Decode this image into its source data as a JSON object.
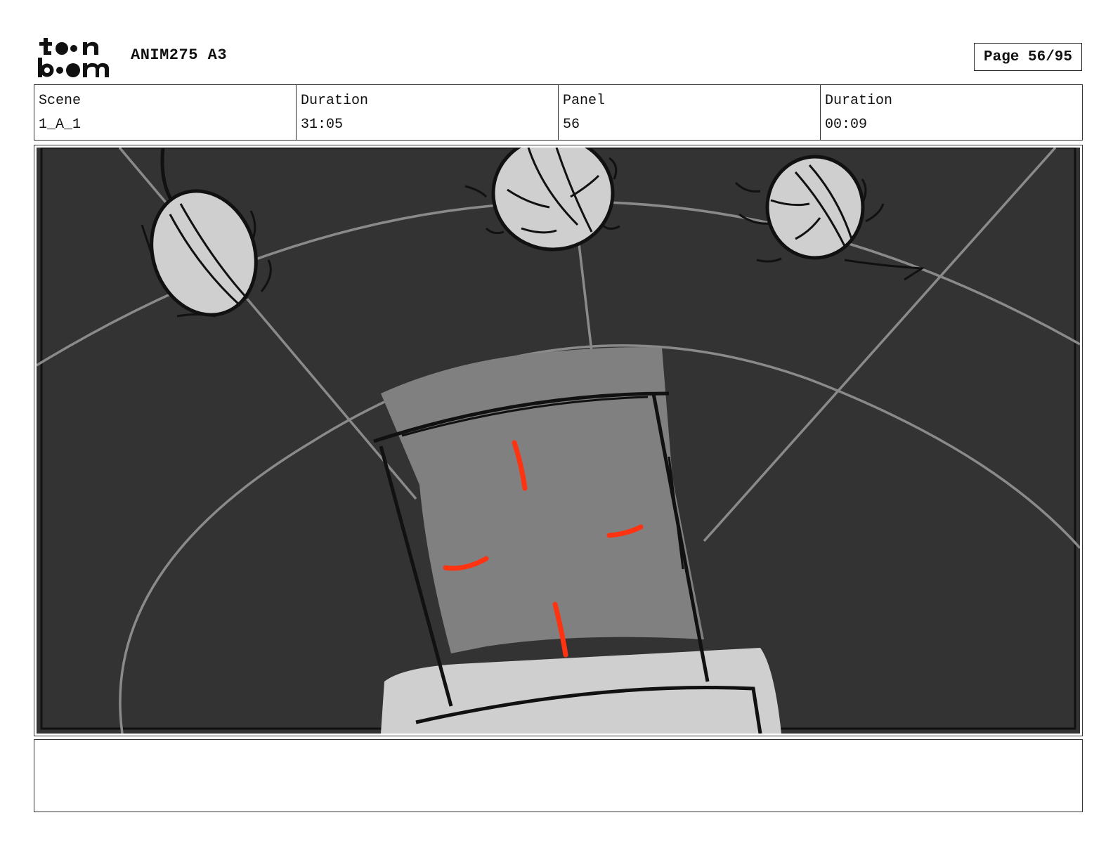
{
  "header": {
    "logo_name": "toon-boom-logo",
    "project_title": "ANIM275 A3",
    "page_label": "Page 56/95"
  },
  "info": {
    "scene_label": "Scene",
    "scene_value": "1_A_1",
    "scene_duration_label": "Duration",
    "scene_duration_value": "31:05",
    "panel_label": "Panel",
    "panel_value": "56",
    "panel_duration_label": "Duration",
    "panel_duration_value": "00:09"
  },
  "panel": {
    "background_color": "#333333",
    "accent_color": "#ff3311"
  },
  "notes": {
    "text": ""
  }
}
